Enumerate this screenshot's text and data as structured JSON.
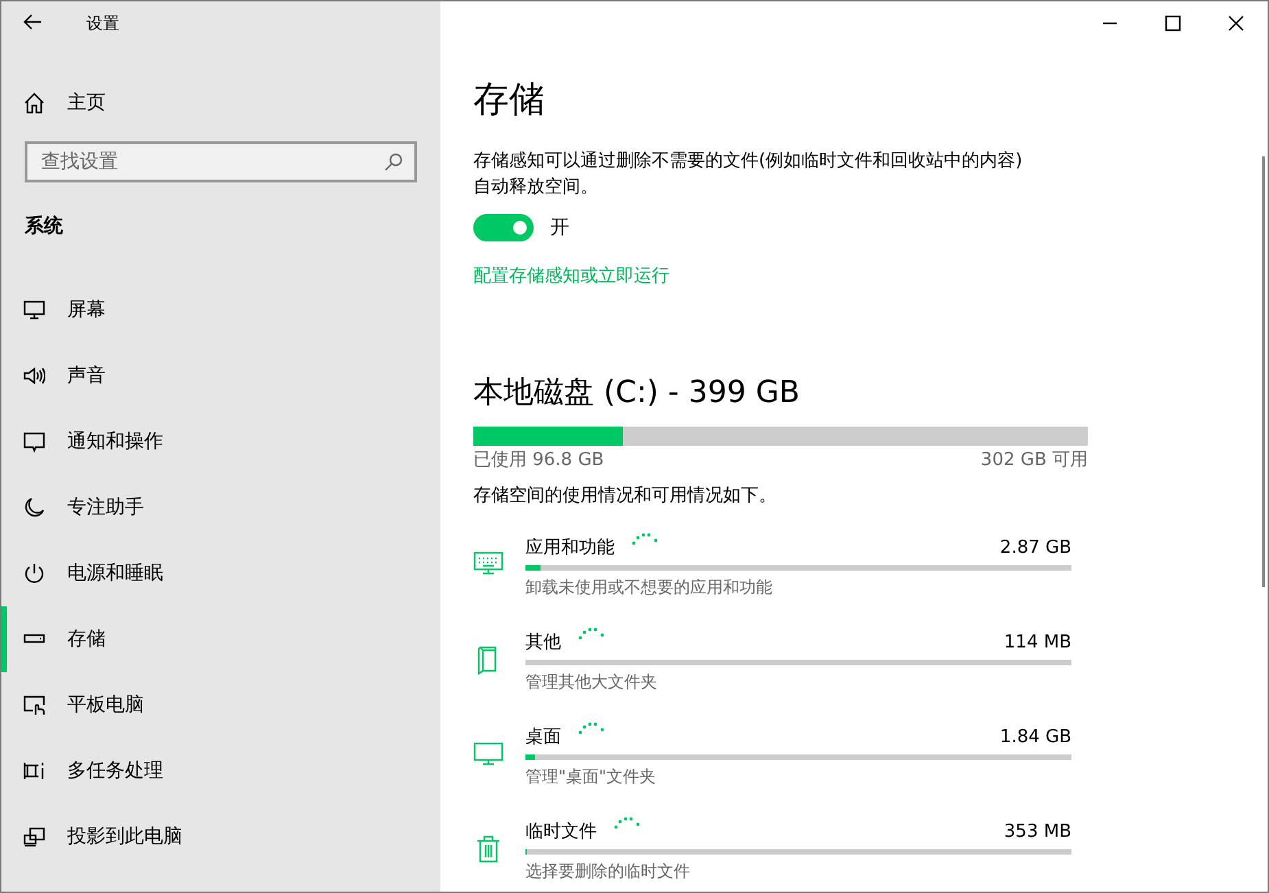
{
  "window": {
    "title": "设置"
  },
  "sidebar": {
    "home": "主页",
    "search": {
      "placeholder": "查找设置"
    },
    "section": "系统",
    "items": [
      {
        "label": "屏幕",
        "selected": false
      },
      {
        "label": "声音",
        "selected": false
      },
      {
        "label": "通知和操作",
        "selected": false
      },
      {
        "label": "专注助手",
        "selected": false
      },
      {
        "label": "电源和睡眠",
        "selected": false
      },
      {
        "label": "存储",
        "selected": true
      },
      {
        "label": "平板电脑",
        "selected": false
      },
      {
        "label": "多任务处理",
        "selected": false
      },
      {
        "label": "投影到此电脑",
        "selected": false
      }
    ]
  },
  "page": {
    "title": "存储",
    "description": "存储感知可以通过删除不需要的文件(例如临时文件和回收站中的内容)自动释放空间。",
    "storage_sense": {
      "on": true,
      "label": "开"
    },
    "link": "配置存储感知或立即运行",
    "disk": {
      "title": "本地磁盘 (C:) - 399 GB",
      "level": 0.243,
      "used": "已使用 96.8 GB",
      "free": "302 GB 可用"
    },
    "caption": "存储空间的使用情况和可用情况如下。",
    "categories": [
      {
        "name": "应用和功能",
        "size": "2.87 GB",
        "level": 0.028,
        "description": "卸载未使用或不想要的应用和功能"
      },
      {
        "name": "其他",
        "size": "114 MB",
        "level": 0.0,
        "description": "管理其他大文件夹"
      },
      {
        "name": "桌面",
        "size": "1.84 GB",
        "level": 0.018,
        "description": "管理\"桌面\"文件夹"
      },
      {
        "name": "临时文件",
        "size": "353 MB",
        "level": 0.003,
        "description": "选择要删除的临时文件"
      }
    ]
  }
}
